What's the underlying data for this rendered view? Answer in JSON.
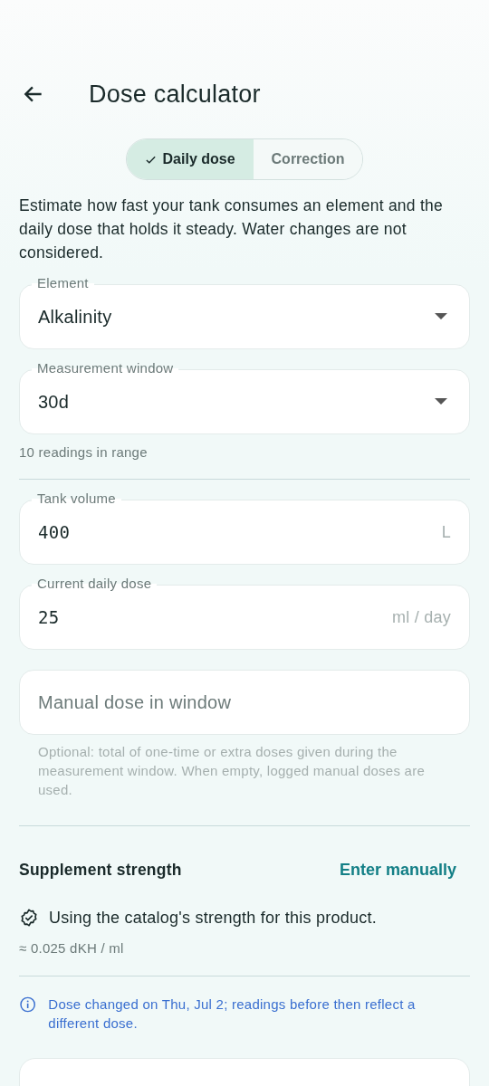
{
  "header": {
    "title": "Dose calculator"
  },
  "mode_tabs": [
    {
      "label": "Daily dose",
      "selected": true
    },
    {
      "label": "Correction",
      "selected": false
    }
  ],
  "description": "Estimate how fast your tank consumes an element and the daily dose that holds it steady. Water changes are not considered.",
  "selectors": [
    {
      "kind": "dropdown",
      "label": "Element",
      "value": "Alkalinity"
    },
    {
      "kind": "dropdown",
      "label": "Measurement window",
      "value": "30d",
      "helper": "10 readings in range"
    }
  ],
  "inputs": [
    {
      "kind": "number",
      "label": "Tank volume",
      "value": "400",
      "unit": "L"
    },
    {
      "kind": "number",
      "label": "Current daily dose",
      "value": "25",
      "unit": "ml / day"
    },
    {
      "kind": "empty",
      "placeholder": "Manual dose in window",
      "helper": "Optional: total of one-time or extra doses given during the measurement window. When empty, logged manual doses are used."
    }
  ],
  "supplement": {
    "title": "Supplement strength",
    "action": "Enter manually",
    "status": "Using the catalog's strength for this product.",
    "strength": "≈ 0.025 dKH / ml"
  },
  "notice": "Dose changed on Thu, Jul 2; readings before then reflect a different dose."
}
